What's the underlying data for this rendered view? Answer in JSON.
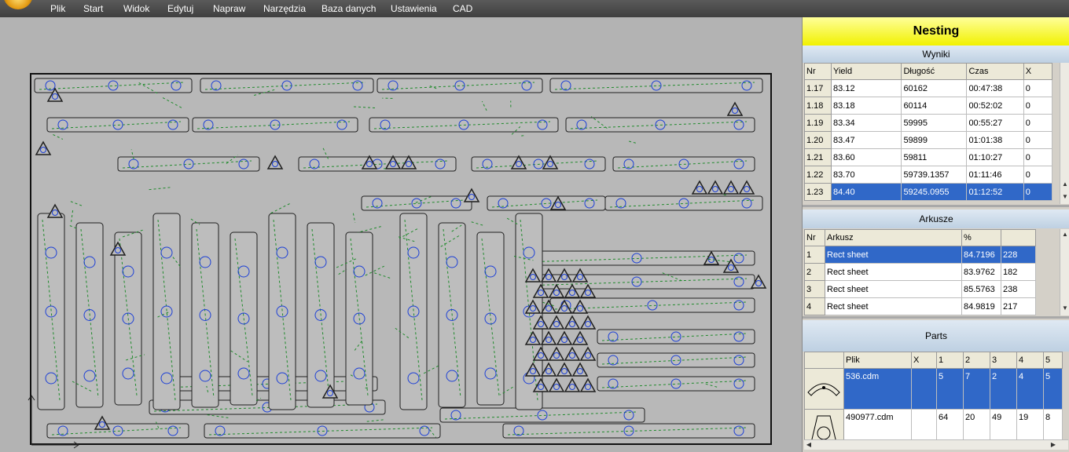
{
  "menu": [
    "Plik",
    "Start",
    "Widok",
    "Edytuj",
    "Napraw",
    "Narzędzia",
    "Baza danych",
    "Ustawienia",
    "CAD"
  ],
  "panel": {
    "title": "Nesting",
    "results": {
      "heading": "Wyniki",
      "columns": [
        "Nr",
        "Yield",
        "Długość",
        "Czas",
        "X"
      ],
      "rows": [
        [
          "1.17",
          "83.12",
          "60162",
          "00:47:38",
          "0"
        ],
        [
          "1.18",
          "83.18",
          "60114",
          "00:52:02",
          "0"
        ],
        [
          "1.19",
          "83.34",
          "59995",
          "00:55:27",
          "0"
        ],
        [
          "1.20",
          "83.47",
          "59899",
          "01:01:38",
          "0"
        ],
        [
          "1.21",
          "83.60",
          "59811",
          "01:10:27",
          "0"
        ],
        [
          "1.22",
          "83.70",
          "59739.1357",
          "01:11:46",
          "0"
        ],
        [
          "1.23",
          "84.40",
          "59245.0955",
          "01:12:52",
          "0"
        ]
      ],
      "selected_index": 6
    },
    "sheets": {
      "heading": "Arkusze",
      "columns": [
        "Nr",
        "Arkusz",
        "%",
        ""
      ],
      "rows": [
        [
          "1",
          "Rect sheet",
          "84.7196",
          "228"
        ],
        [
          "2",
          "Rect sheet",
          "83.9762",
          "182"
        ],
        [
          "3",
          "Rect sheet",
          "85.5763",
          "238"
        ],
        [
          "4",
          "Rect sheet",
          "84.9819",
          "217"
        ]
      ],
      "selected_index": 0
    },
    "parts": {
      "heading": "Parts",
      "columns": [
        "",
        "Plik",
        "X",
        "1",
        "2",
        "3",
        "4",
        "5"
      ],
      "rows": [
        {
          "thumb": "arc-part-thumbnail",
          "cells": [
            "536.cdm",
            "",
            "5",
            "7",
            "2",
            "4",
            "5"
          ]
        },
        {
          "thumb": "round-part-thumbnail",
          "cells": [
            "490977.cdm",
            "",
            "64",
            "20",
            "49",
            "19",
            "8"
          ]
        }
      ],
      "selected_index": 0
    }
  },
  "colors": {
    "outline": "#1f1f1f",
    "part_hole": "#1c3fd6",
    "toolpath": "#1f8a2b",
    "selection": "#3068c8",
    "title_bg": "#f1f100"
  }
}
